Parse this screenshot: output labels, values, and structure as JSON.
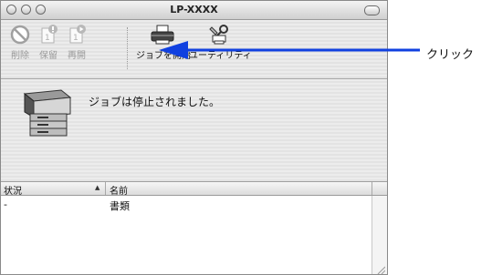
{
  "window": {
    "title": "LP-XXXX"
  },
  "toolbar": {
    "items": [
      {
        "label": "削除",
        "icon": "delete-icon",
        "enabled": false
      },
      {
        "label": "保留",
        "icon": "hold-icon",
        "enabled": false
      },
      {
        "label": "再開",
        "icon": "resume-icon",
        "enabled": false
      },
      {
        "label": "ジョブを開始",
        "icon": "printer-icon",
        "enabled": true
      },
      {
        "label": "ユーティリティ",
        "icon": "utility-icon",
        "enabled": true
      }
    ]
  },
  "status": {
    "message": "ジョブは停止されました。",
    "icon": "printer-device-icon"
  },
  "table": {
    "columns": [
      {
        "label": "状況",
        "sorted": true
      },
      {
        "label": "名前"
      }
    ],
    "rows": [
      {
        "status": "-",
        "name": "書類"
      }
    ]
  },
  "annotation": {
    "label": "クリック",
    "color": "#1040e0"
  }
}
